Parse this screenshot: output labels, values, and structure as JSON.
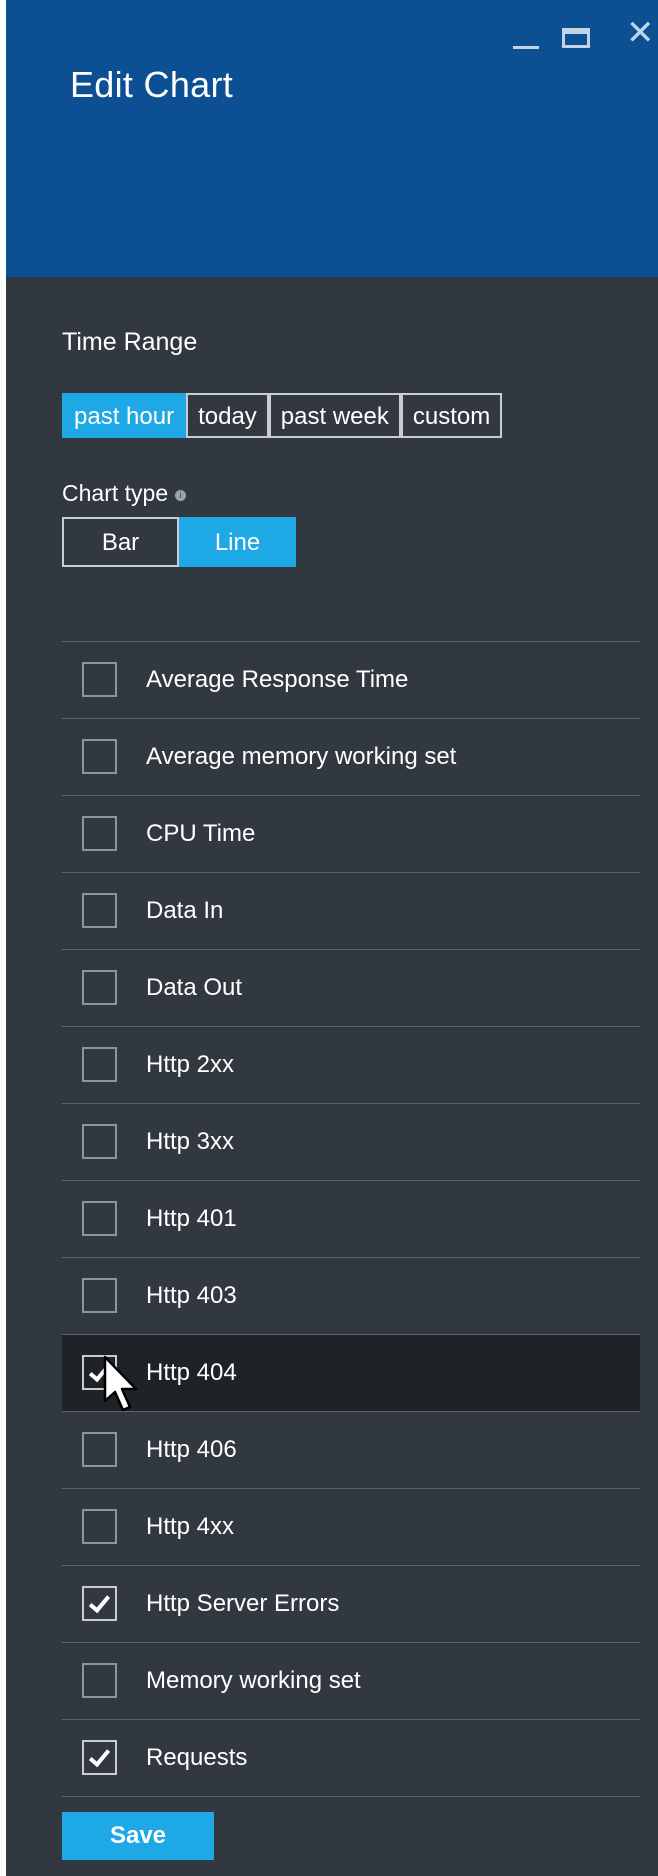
{
  "header": {
    "title": "Edit Chart"
  },
  "time_range": {
    "label": "Time Range",
    "options": [
      "past hour",
      "today",
      "past week",
      "custom"
    ],
    "selected": "past hour"
  },
  "chart_type": {
    "label": "Chart type",
    "options": [
      "Bar",
      "Line"
    ],
    "selected": "Line"
  },
  "metrics": [
    {
      "label": "Average Response Time",
      "checked": false
    },
    {
      "label": "Average memory working set",
      "checked": false
    },
    {
      "label": "CPU Time",
      "checked": false
    },
    {
      "label": "Data In",
      "checked": false
    },
    {
      "label": "Data Out",
      "checked": false
    },
    {
      "label": "Http 2xx",
      "checked": false
    },
    {
      "label": "Http 3xx",
      "checked": false
    },
    {
      "label": "Http 401",
      "checked": false
    },
    {
      "label": "Http 403",
      "checked": false
    },
    {
      "label": "Http 404",
      "checked": true,
      "hovered": true
    },
    {
      "label": "Http 406",
      "checked": false
    },
    {
      "label": "Http 4xx",
      "checked": false
    },
    {
      "label": "Http Server Errors",
      "checked": true
    },
    {
      "label": "Memory working set",
      "checked": false
    },
    {
      "label": "Requests",
      "checked": true
    }
  ],
  "save_label": "Save",
  "colors": {
    "header": "#0c4f93",
    "panel": "#32383f",
    "accent": "#1ea8e6"
  },
  "icons": {
    "minimize": "minimize-icon",
    "maximize": "maximize-icon",
    "close": "close-icon",
    "info": "info-icon",
    "cursor": "mouse-pointer-icon"
  }
}
